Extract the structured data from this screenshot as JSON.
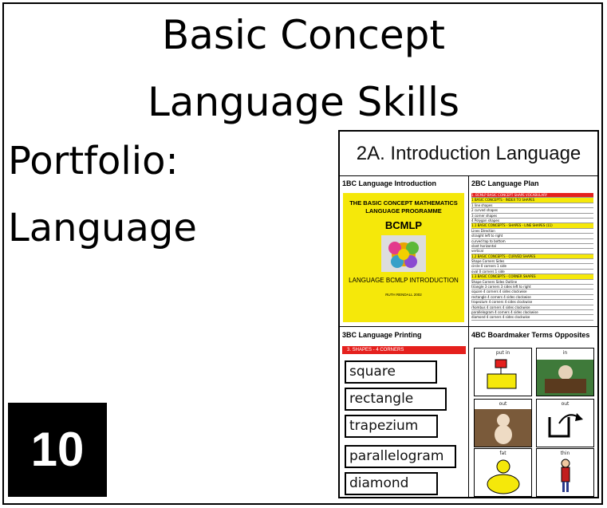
{
  "title": {
    "line1": "Basic Concept",
    "line2": "Language Skills"
  },
  "portfolio": {
    "line1": "Portfolio:",
    "line2": "Language"
  },
  "badge": "10",
  "preview": {
    "title": "2A. Introduction Language",
    "cell1": {
      "label": "1BC Language Introduction",
      "heading": "THE BASIC CONCEPT MATHEMATICS LANGUAGE PROGRAMME",
      "acronym": "BCMLP",
      "subtitle": "LANGUAGE BCMLP INTRODUCTION",
      "footer": "RUTH RENDALL 2002"
    },
    "cell2": {
      "label": "2BC Language Plan",
      "rows": [
        "1. BCMLP BASIC CONCEPT SHAPE VOCABULARY",
        "1  BASIC CONCEPTS - INDEX TO SHAPES",
        "1   line shapes",
        "2   curved shapes",
        "3   corner shapes",
        "4   Polygon shapes",
        "1.1  BASIC CONCEPTS - SHAPES - LINE SHAPES (11)",
        "Lines    Direction",
        "straight   left to right",
        "curved   top to bottom",
        "slant   horizontal",
        "vertical",
        "1.2  BASIC CONCEPTS - CURVED SHAPES",
        "Shape   Corners   Sides",
        "circle   0 corners   1 side",
        "oval   0 corners   1 side",
        "1.3  BASIC CONCEPTS - CORNER SHAPES",
        "Shape   Corners   Sides   Outline",
        "triangle   3 corners   3 sides   left to right",
        "square   4 corners   4 sides   clockwise",
        "rectangle   4 corners   4 sides   clockwise",
        "trapezium   4 corners   4 sides   clockwise",
        "rhombus   4 corners   4 sides   clockwise",
        "parallelogram   4 corners   4 sides   clockwise",
        "diamond   4 corners   4 sides   clockwise"
      ]
    },
    "cell3": {
      "label": "3BC Language Printing",
      "bar": "3.  SHAPES - 4 CORNERS",
      "words": [
        "square",
        "rectangle",
        "trapezium",
        "parallelogram",
        "diamond"
      ]
    },
    "cell4": {
      "label": "4BC Boardmaker Terms Opposites",
      "pics": [
        "put in",
        "in",
        "out",
        "out",
        "fat",
        "thin"
      ]
    }
  },
  "colors": {
    "badge": "#000000",
    "yellow": "#f5e80a",
    "red": "#e5201d"
  }
}
